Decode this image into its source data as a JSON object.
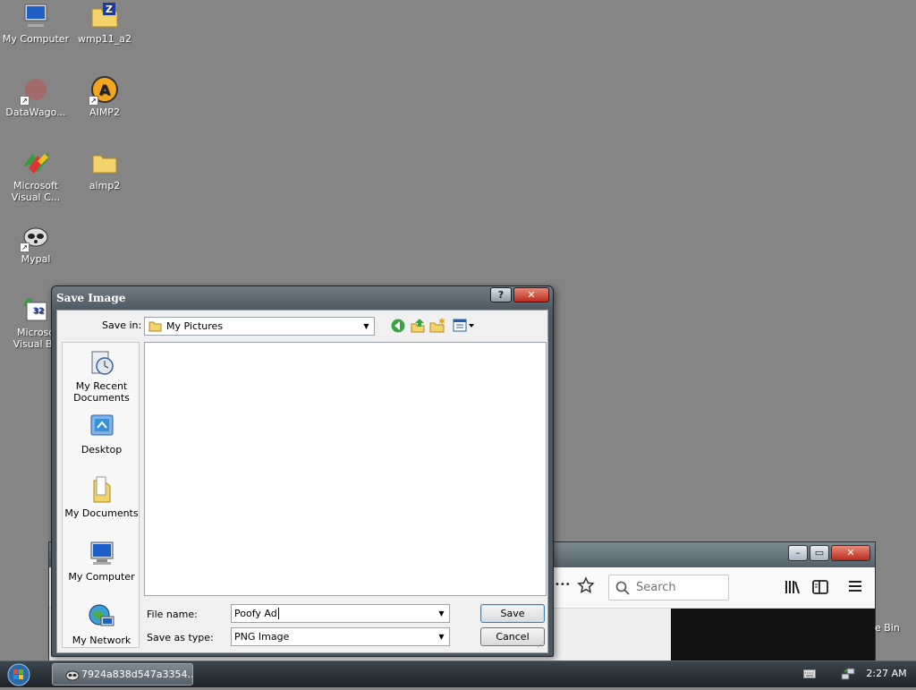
{
  "desktop": {
    "icons": [
      {
        "label": "My Computer",
        "icon": "computer-icon"
      },
      {
        "label": "wmp11_a2",
        "icon": "zip-folder-icon"
      },
      {
        "label": "DataWago...",
        "icon": "app-shortcut-icon"
      },
      {
        "label": "AIMP2",
        "icon": "aimp-icon"
      },
      {
        "label": "Microsoft Visual C...",
        "icon": "visual-cpp-icon"
      },
      {
        "label": "aimp2",
        "icon": "folder-icon"
      },
      {
        "label": "Mypal",
        "icon": "mypal-icon"
      },
      {
        "label": "Microso Visual Ba",
        "icon": "visual-basic-icon"
      }
    ],
    "recycle_bin_label": "e Bin"
  },
  "browser": {
    "search_placeholder": "Search",
    "overflow_label": "•••",
    "icons": [
      "star-icon",
      "library-icon",
      "sidebar-icon",
      "menu-icon"
    ]
  },
  "dialog": {
    "title": "Save Image",
    "help_label": "?",
    "close_label": "✕",
    "save_in_label": "Save in:",
    "save_in_value": "My Pictures",
    "places": [
      {
        "label": "My Recent Documents",
        "icon": "recent-documents-icon"
      },
      {
        "label": "Desktop",
        "icon": "desktop-icon"
      },
      {
        "label": "My Documents",
        "icon": "my-documents-icon"
      },
      {
        "label": "My Computer",
        "icon": "my-computer-icon"
      },
      {
        "label": "My Network",
        "icon": "my-network-icon"
      }
    ],
    "file_name_label": "File name:",
    "file_name_value": "Poofy Ad",
    "save_as_type_label": "Save as type:",
    "save_as_type_value": "PNG Image",
    "save_button": "Save",
    "cancel_button": "Cancel"
  },
  "taskbar": {
    "task_label": "7924a838d547a3354...",
    "clock": "2:27 AM"
  }
}
